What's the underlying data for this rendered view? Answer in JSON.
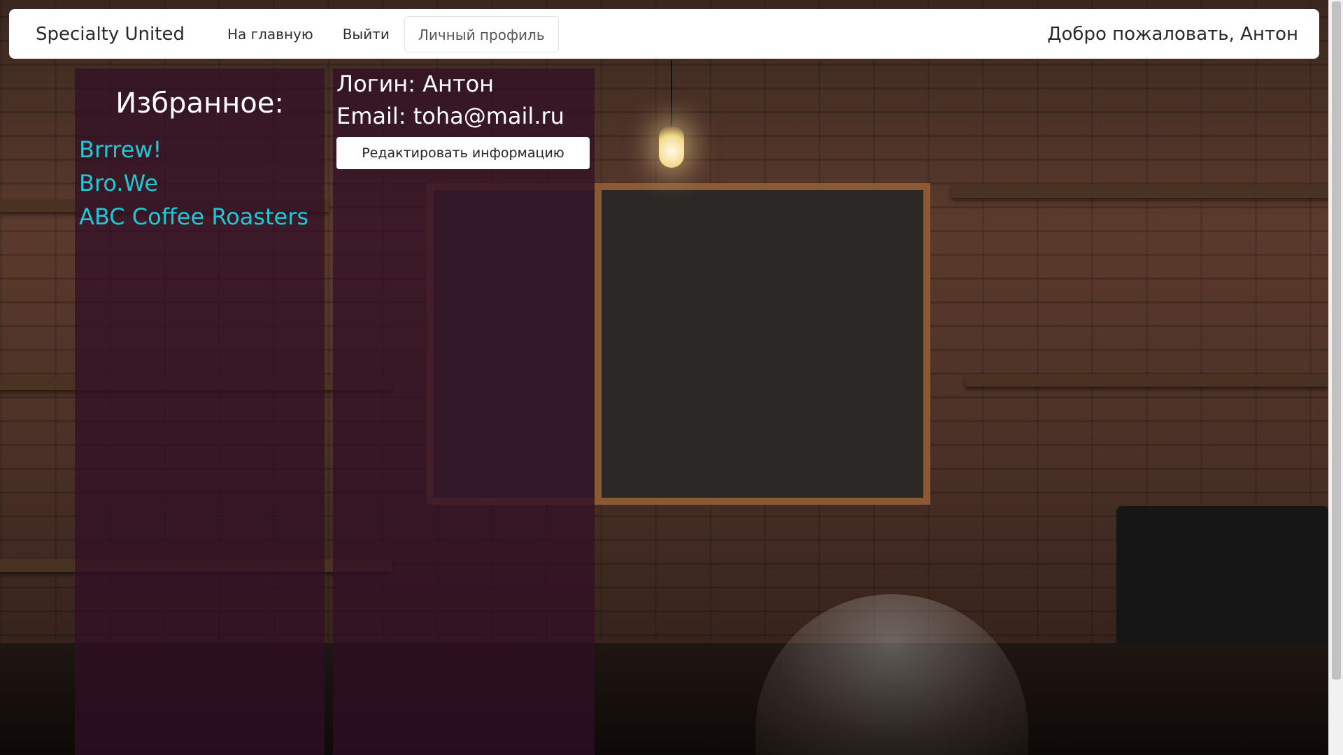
{
  "navbar": {
    "brand": "Specialty United",
    "links": [
      {
        "label": "На главную"
      },
      {
        "label": "Выйти"
      },
      {
        "label": "Личный профиль"
      }
    ],
    "welcome": "Добро пожаловать, Антон"
  },
  "favorites": {
    "title": "Избранное:",
    "items": [
      {
        "label": "Brrrew!"
      },
      {
        "label": "Bro.We"
      },
      {
        "label": "ABC Coffee Roasters"
      }
    ],
    "link_color": "#21c7d6"
  },
  "profile": {
    "login": "Логин: Антон",
    "email": "Email: toha@mail.ru",
    "edit_button": "Редактировать информацию"
  },
  "colors": {
    "panel_overlay": "#300e26",
    "navbar_bg": "#ffffff"
  }
}
